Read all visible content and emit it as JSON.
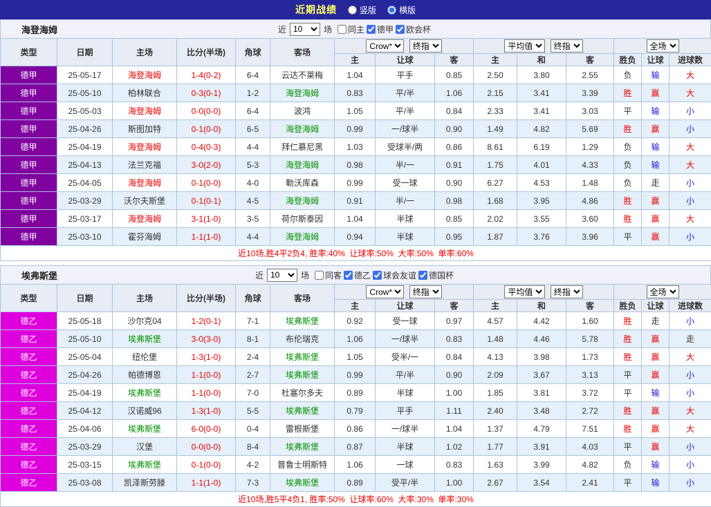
{
  "topbar": {
    "title": "近期战绩",
    "radios": [
      {
        "label": "竖版",
        "checked": false
      },
      {
        "label": "横版",
        "checked": true
      }
    ]
  },
  "header_selects": {
    "bookmaker": "Crow*",
    "final": "终指",
    "average": "平均值",
    "final2": "终指",
    "full": "全场"
  },
  "columns": {
    "type": "类型",
    "date": "日期",
    "home": "主场",
    "score": "比分(半场)",
    "corner": "角球",
    "away": "客场",
    "asia_home": "主",
    "asia_handicap": "让球",
    "asia_away": "客",
    "euro_home": "主",
    "euro_draw": "和",
    "euro_away": "客",
    "result": "胜负",
    "handicap_result": "让球",
    "goals": "进球数"
  },
  "colors": {
    "red": "#e60000",
    "green": "#009100",
    "blue": "#1a1ad1",
    "dark": "#333333",
    "text": "#333333",
    "summary": "#e60000",
    "topbar_bg": "#26269b",
    "title_text": "#ffff66",
    "stripe": "#e6f0fa",
    "grid_border": "#aac4de"
  },
  "sections": [
    {
      "team": "海登海姆",
      "league_color": "#8000a0",
      "filter": {
        "prefix": "近",
        "count": "10",
        "suffix": "场",
        "checks": [
          {
            "label": "同主",
            "checked": false
          },
          {
            "label": "德甲",
            "checked": true
          },
          {
            "label": "欧会杯",
            "checked": true
          }
        ]
      },
      "rows": [
        {
          "league": "德甲",
          "date": "25-05-17",
          "home": "海登海姆",
          "hc": "red",
          "score": "1-4(0-2)",
          "corner": "6-4",
          "away": "云达不莱梅",
          "ac": "",
          "odds": [
            "1.04",
            "平手",
            "0.85",
            "2.50",
            "3.80",
            "2.55"
          ],
          "res": [
            "负",
            "输",
            "大"
          ],
          "resc": [
            "dark",
            "blue",
            "red"
          ]
        },
        {
          "league": "德甲",
          "date": "25-05-10",
          "home": "柏林联合",
          "hc": "",
          "score": "0-3(0-1)",
          "corner": "1-2",
          "away": "海登海姆",
          "ac": "green",
          "odds": [
            "0.83",
            "平/半",
            "1.06",
            "2.15",
            "3.41",
            "3.39"
          ],
          "res": [
            "胜",
            "赢",
            "大"
          ],
          "resc": [
            "red",
            "red",
            "red"
          ]
        },
        {
          "league": "德甲",
          "date": "25-05-03",
          "home": "海登海姆",
          "hc": "red",
          "score": "0-0(0-0)",
          "corner": "6-4",
          "away": "波鸿",
          "ac": "",
          "odds": [
            "1.05",
            "平/半",
            "0.84",
            "2.33",
            "3.41",
            "3.03"
          ],
          "res": [
            "平",
            "输",
            "小"
          ],
          "resc": [
            "dark",
            "blue",
            "blue"
          ]
        },
        {
          "league": "德甲",
          "date": "25-04-26",
          "home": "斯图加特",
          "hc": "",
          "score": "0-1(0-0)",
          "corner": "6-5",
          "away": "海登海姆",
          "ac": "green",
          "odds": [
            "0.99",
            "一/球半",
            "0.90",
            "1.49",
            "4.82",
            "5.69"
          ],
          "res": [
            "胜",
            "赢",
            "小"
          ],
          "resc": [
            "red",
            "red",
            "blue"
          ]
        },
        {
          "league": "德甲",
          "date": "25-04-19",
          "home": "海登海姆",
          "hc": "red",
          "score": "0-4(0-3)",
          "corner": "4-4",
          "away": "拜仁慕尼黑",
          "ac": "",
          "odds": [
            "1.03",
            "受球半/两",
            "0.86",
            "8.61",
            "6.19",
            "1.29"
          ],
          "res": [
            "负",
            "输",
            "大"
          ],
          "resc": [
            "dark",
            "blue",
            "red"
          ]
        },
        {
          "league": "德甲",
          "date": "25-04-13",
          "home": "法兰克福",
          "hc": "",
          "score": "3-0(2-0)",
          "corner": "5-3",
          "away": "海登海姆",
          "ac": "green",
          "odds": [
            "0.98",
            "半/一",
            "0.91",
            "1.75",
            "4.01",
            "4.33"
          ],
          "res": [
            "负",
            "输",
            "大"
          ],
          "resc": [
            "dark",
            "blue",
            "red"
          ]
        },
        {
          "league": "德甲",
          "date": "25-04-05",
          "home": "海登海姆",
          "hc": "red",
          "score": "0-1(0-0)",
          "corner": "4-0",
          "away": "勒沃库森",
          "ac": "",
          "odds": [
            "0.99",
            "受一球",
            "0.90",
            "6.27",
            "4.53",
            "1.48"
          ],
          "res": [
            "负",
            "走",
            "小"
          ],
          "resc": [
            "dark",
            "dark",
            "blue"
          ]
        },
        {
          "league": "德甲",
          "date": "25-03-29",
          "home": "沃尔夫斯堡",
          "hc": "",
          "score": "0-1(0-1)",
          "corner": "4-5",
          "away": "海登海姆",
          "ac": "green",
          "odds": [
            "0.91",
            "半/一",
            "0.98",
            "1.68",
            "3.95",
            "4.86"
          ],
          "res": [
            "胜",
            "赢",
            "小"
          ],
          "resc": [
            "red",
            "red",
            "blue"
          ]
        },
        {
          "league": "德甲",
          "date": "25-03-17",
          "home": "海登海姆",
          "hc": "red",
          "score": "3-1(1-0)",
          "corner": "3-5",
          "away": "荷尔斯泰因",
          "ac": "",
          "odds": [
            "1.04",
            "半球",
            "0.85",
            "2.02",
            "3.55",
            "3.60"
          ],
          "res": [
            "胜",
            "赢",
            "大"
          ],
          "resc": [
            "red",
            "red",
            "red"
          ]
        },
        {
          "league": "德甲",
          "date": "25-03-10",
          "home": "霍芬海姆",
          "hc": "",
          "score": "1-1(1-0)",
          "corner": "4-4",
          "away": "海登海姆",
          "ac": "green",
          "odds": [
            "0.94",
            "半球",
            "0.95",
            "1.87",
            "3.76",
            "3.96"
          ],
          "res": [
            "平",
            "赢",
            "小"
          ],
          "resc": [
            "dark",
            "red",
            "blue"
          ]
        }
      ],
      "summary": "近10场,胜4平2负4, 胜率:40%  让球率:50%  大率:50%  单率:60%"
    },
    {
      "team": "埃弗斯堡",
      "league_color": "#dd00dd",
      "filter": {
        "prefix": "近",
        "count": "10",
        "suffix": "场",
        "checks": [
          {
            "label": "同客",
            "checked": false
          },
          {
            "label": "德乙",
            "checked": true
          },
          {
            "label": "球会友谊",
            "checked": true
          },
          {
            "label": "德国杯",
            "checked": true
          }
        ]
      },
      "rows": [
        {
          "league": "德乙",
          "date": "25-05-18",
          "home": "沙尔克04",
          "hc": "",
          "score": "1-2(0-1)",
          "corner": "7-1",
          "away": "埃弗斯堡",
          "ac": "green",
          "odds": [
            "0.92",
            "受一球",
            "0.97",
            "4.57",
            "4.42",
            "1.60"
          ],
          "res": [
            "胜",
            "走",
            "小"
          ],
          "resc": [
            "red",
            "dark",
            "blue"
          ]
        },
        {
          "league": "德乙",
          "date": "25-05-10",
          "home": "埃弗斯堡",
          "hc": "green",
          "score": "3-0(3-0)",
          "corner": "8-1",
          "away": "布伦瑞克",
          "ac": "",
          "odds": [
            "1.06",
            "一/球半",
            "0.83",
            "1.48",
            "4.46",
            "5.78"
          ],
          "res": [
            "胜",
            "赢",
            "走"
          ],
          "resc": [
            "red",
            "red",
            "dark"
          ]
        },
        {
          "league": "德乙",
          "date": "25-05-04",
          "home": "纽伦堡",
          "hc": "",
          "score": "1-3(1-0)",
          "corner": "2-4",
          "away": "埃弗斯堡",
          "ac": "green",
          "odds": [
            "1.05",
            "受半/一",
            "0.84",
            "4.13",
            "3.98",
            "1.73"
          ],
          "res": [
            "胜",
            "赢",
            "大"
          ],
          "resc": [
            "red",
            "red",
            "red"
          ]
        },
        {
          "league": "德乙",
          "date": "25-04-26",
          "home": "帕德博恩",
          "hc": "",
          "score": "1-1(0-0)",
          "corner": "2-7",
          "away": "埃弗斯堡",
          "ac": "green",
          "odds": [
            "0.99",
            "平/半",
            "0.90",
            "2.09",
            "3.67",
            "3.13"
          ],
          "res": [
            "平",
            "赢",
            "小"
          ],
          "resc": [
            "dark",
            "red",
            "blue"
          ]
        },
        {
          "league": "德乙",
          "date": "25-04-19",
          "home": "埃弗斯堡",
          "hc": "green",
          "score": "1-1(0-0)",
          "corner": "7-0",
          "away": "杜塞尔多夫",
          "ac": "",
          "odds": [
            "0.89",
            "半球",
            "1.00",
            "1.85",
            "3.81",
            "3.72"
          ],
          "res": [
            "平",
            "输",
            "小"
          ],
          "resc": [
            "dark",
            "blue",
            "blue"
          ]
        },
        {
          "league": "德乙",
          "date": "25-04-12",
          "home": "汉诺威96",
          "hc": "",
          "score": "1-3(1-0)",
          "corner": "5-5",
          "away": "埃弗斯堡",
          "ac": "green",
          "odds": [
            "0.79",
            "平手",
            "1.11",
            "2.40",
            "3.48",
            "2.72"
          ],
          "res": [
            "胜",
            "赢",
            "大"
          ],
          "resc": [
            "red",
            "red",
            "red"
          ]
        },
        {
          "league": "德乙",
          "date": "25-04-06",
          "home": "埃弗斯堡",
          "hc": "green",
          "score": "6-0(0-0)",
          "corner": "0-4",
          "away": "雷根斯堡",
          "ac": "",
          "odds": [
            "0.86",
            "一/球半",
            "1.04",
            "1.37",
            "4.79",
            "7.51"
          ],
          "res": [
            "胜",
            "赢",
            "大"
          ],
          "resc": [
            "red",
            "red",
            "red"
          ]
        },
        {
          "league": "德乙",
          "date": "25-03-29",
          "home": "汉堡",
          "hc": "",
          "score": "0-0(0-0)",
          "corner": "8-4",
          "away": "埃弗斯堡",
          "ac": "green",
          "odds": [
            "0.87",
            "半球",
            "1.02",
            "1.77",
            "3.91",
            "4.03"
          ],
          "res": [
            "平",
            "赢",
            "小"
          ],
          "resc": [
            "dark",
            "red",
            "blue"
          ]
        },
        {
          "league": "德乙",
          "date": "25-03-15",
          "home": "埃弗斯堡",
          "hc": "green",
          "score": "0-1(0-0)",
          "corner": "4-2",
          "away": "普鲁士明斯特",
          "ac": "",
          "odds": [
            "1.06",
            "一球",
            "0.83",
            "1.63",
            "3.99",
            "4.82"
          ],
          "res": [
            "负",
            "输",
            "小"
          ],
          "resc": [
            "dark",
            "blue",
            "blue"
          ]
        },
        {
          "league": "德乙",
          "date": "25-03-08",
          "home": "凯泽斯劳滕",
          "hc": "",
          "score": "1-1(1-0)",
          "corner": "7-3",
          "away": "埃弗斯堡",
          "ac": "green",
          "odds": [
            "0.89",
            "受平/半",
            "1.00",
            "2.67",
            "3.54",
            "2.41"
          ],
          "res": [
            "平",
            "输",
            "小"
          ],
          "resc": [
            "dark",
            "blue",
            "blue"
          ]
        }
      ],
      "summary": "近10场,胜5平4负1, 胜率:50%  让球率:60%  大率:30%  单率:30%"
    }
  ]
}
